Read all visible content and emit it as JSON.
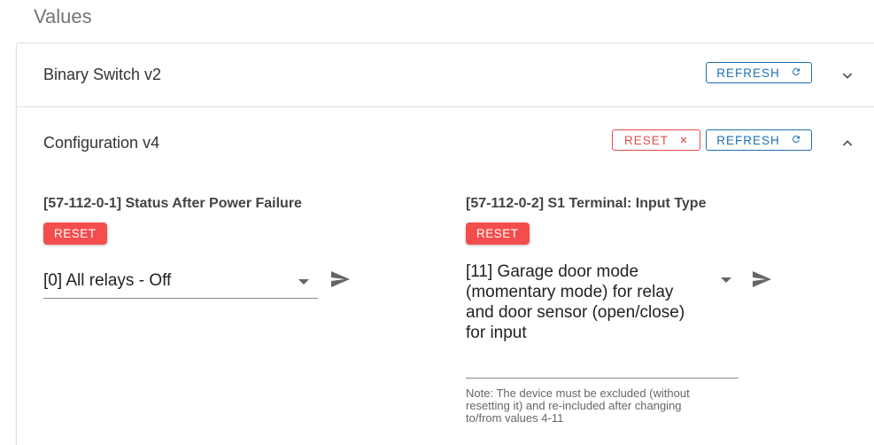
{
  "section_title": "Values",
  "rows": [
    {
      "title": "Binary Switch v2",
      "refresh_label": "REFRESH",
      "expanded": false
    },
    {
      "title": "Configuration v4",
      "reset_label": "RESET",
      "refresh_label": "REFRESH",
      "expanded": true
    }
  ],
  "fields": [
    {
      "label": "[57-112-0-1] Status After Power Failure",
      "reset_label": "RESET",
      "value": "[0] All relays - Off",
      "note": ""
    },
    {
      "label": "[57-112-0-2] S1 Terminal: Input Type",
      "reset_label": "RESET",
      "value_lines": [
        "[11] Garage door mode",
        "(momentary mode) for relay",
        "and door sensor (open/close)",
        "for input"
      ],
      "note_lines": [
        "Note: The device must be excluded (without",
        "resetting it) and re-included after changing",
        "to/from values 4-11"
      ]
    }
  ],
  "icons": {
    "refresh": "refresh-icon",
    "close": "close-icon",
    "chevron_down": "chevron-down-icon",
    "chevron_up": "chevron-up-icon",
    "send": "send-icon",
    "dropdown": "dropdown-arrow-icon"
  },
  "colors": {
    "primary": "#1f6fb5",
    "danger": "#f44d4d"
  }
}
